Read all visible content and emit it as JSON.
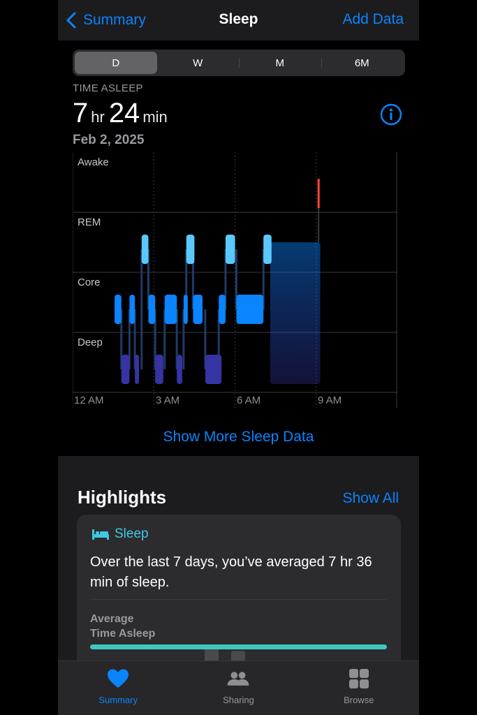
{
  "nav": {
    "back_label": "Summary",
    "title": "Sleep",
    "action_label": "Add Data"
  },
  "segments": [
    "D",
    "W",
    "M",
    "6M"
  ],
  "selected_segment": "D",
  "summary": {
    "label": "TIME ASLEEP",
    "hours": "7",
    "hours_unit": "hr",
    "minutes": "24",
    "minutes_unit": "min",
    "date": "Feb 2, 2025"
  },
  "chart": {
    "stage_labels": [
      "Awake",
      "REM",
      "Core",
      "Deep"
    ],
    "x_labels": [
      "12 AM",
      "3 AM",
      "6 AM",
      "9 AM"
    ]
  },
  "chart_data": {
    "type": "sleep-stages",
    "x_range_hours": [
      0,
      12
    ],
    "stages": [
      "Awake",
      "REM",
      "Core",
      "Deep"
    ],
    "segments": [
      {
        "stage": "Core",
        "start": 1.55,
        "end": 1.8
      },
      {
        "stage": "Deep",
        "start": 1.8,
        "end": 2.1
      },
      {
        "stage": "Core",
        "start": 2.1,
        "end": 2.3
      },
      {
        "stage": "Deep",
        "start": 2.3,
        "end": 2.4
      },
      {
        "stage": "REM",
        "start": 2.55,
        "end": 2.8
      },
      {
        "stage": "Core",
        "start": 2.8,
        "end": 3.05
      },
      {
        "stage": "Deep",
        "start": 3.05,
        "end": 3.35
      },
      {
        "stage": "Core",
        "start": 3.4,
        "end": 3.85
      },
      {
        "stage": "Deep",
        "start": 3.85,
        "end": 4.05
      },
      {
        "stage": "Core",
        "start": 4.1,
        "end": 4.25
      },
      {
        "stage": "REM",
        "start": 4.2,
        "end": 4.5
      },
      {
        "stage": "Core",
        "start": 4.45,
        "end": 4.8
      },
      {
        "stage": "Deep",
        "start": 4.9,
        "end": 5.5
      },
      {
        "stage": "Core",
        "start": 5.4,
        "end": 5.65
      },
      {
        "stage": "REM",
        "start": 5.65,
        "end": 6.0
      },
      {
        "stage": "Core",
        "start": 6.05,
        "end": 7.05
      },
      {
        "stage": "REM",
        "start": 7.05,
        "end": 7.35
      },
      {
        "stage": "Awake",
        "start": 9.05,
        "end": 9.15
      }
    ],
    "in_bed_range": [
      7.35,
      9.15
    ],
    "grid": true
  },
  "show_more_label": "Show More Sleep Data",
  "highlights": {
    "title": "Highlights",
    "show_all_label": "Show All",
    "card": {
      "category": "Sleep",
      "text": "Over the last 7 days, you’ve averaged 7 hr 36 min of sleep.",
      "metric_line1": "Average",
      "metric_line2": "Time Asleep",
      "bar_color": "#40c8c0"
    }
  },
  "tabs": [
    {
      "label": "Summary",
      "icon": "heart-icon",
      "active": true
    },
    {
      "label": "Sharing",
      "icon": "people-icon",
      "active": false
    },
    {
      "label": "Browse",
      "icon": "grid-icon",
      "active": false
    }
  ],
  "colors": {
    "accent": "#0a84ff",
    "awake": "#ff453a",
    "rem": "#5ac8fa",
    "core": "#0a84ff",
    "deep": "#3634a3",
    "highlight": "#40c8e0"
  }
}
